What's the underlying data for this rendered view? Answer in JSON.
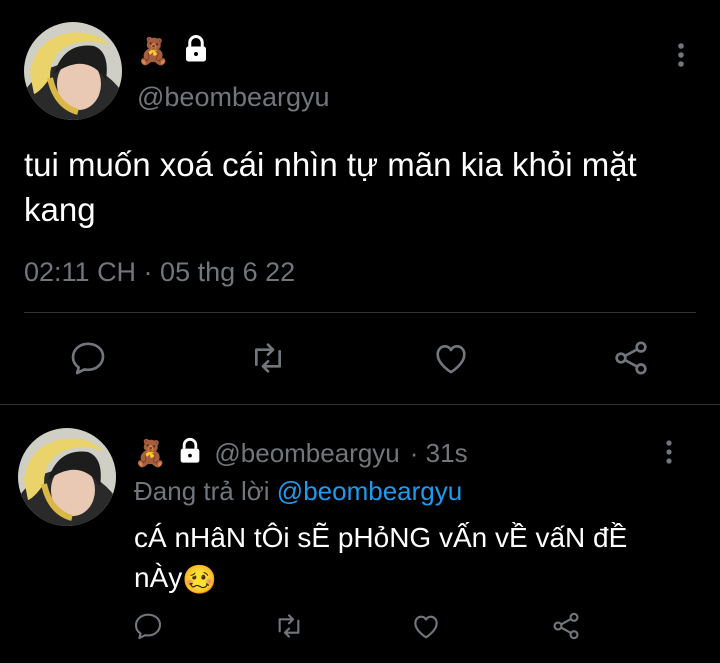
{
  "main_tweet": {
    "handle": "@beombeargyu",
    "text": "tui muốn xoá cái nhìn tự mãn kia khỏi mặt kang",
    "timestamp": "02:11 CH · 05 thg 6 22",
    "name_emoji": "🧸",
    "protected_icon": "lock-icon"
  },
  "reply_tweet": {
    "handle": "@beombeargyu",
    "time_ago": "· 31s",
    "replying_label": "Đang trả lời",
    "replying_to": "@beombeargyu",
    "text": "cÁ nHâN tÔi sẼ pHỏNG vẤn vỀ vấN đỀ nÀy",
    "text_emoji": "🥴"
  },
  "actions": [
    "reply-icon",
    "retweet-icon",
    "like-icon",
    "share-icon"
  ],
  "colors": {
    "background": "#000000",
    "text": "#e7e9ea",
    "muted": "#71767b",
    "accent": "#1d9bf0",
    "divider": "#2f3336"
  }
}
